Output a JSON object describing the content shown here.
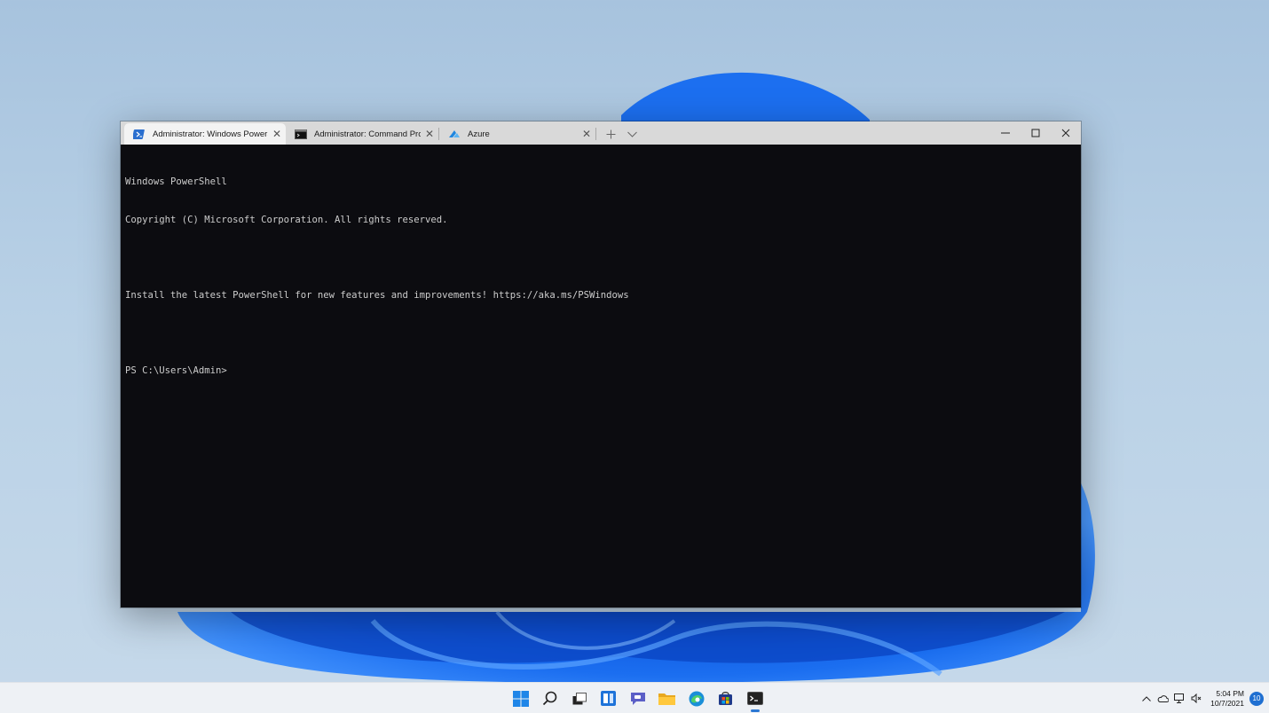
{
  "window": {
    "tabs": [
      {
        "label": "Administrator: Windows PowerS",
        "icon": "powershell-icon",
        "active": true
      },
      {
        "label": "Administrator: Command Promp",
        "icon": "command-prompt-icon",
        "active": false
      },
      {
        "label": "Azure",
        "icon": "azure-icon",
        "active": false
      }
    ],
    "new_tab_glyph": "+",
    "dropdown_glyph": "⌄",
    "close_glyph": "✕"
  },
  "console": {
    "lines": [
      "Windows PowerShell",
      "Copyright (C) Microsoft Corporation. All rights reserved.",
      "",
      "Install the latest PowerShell for new features and improvements! https://aka.ms/PSWindows",
      "",
      "PS C:\\Users\\Admin>"
    ]
  },
  "taskbar": {
    "apps": [
      "start-icon",
      "search-icon",
      "task-view-icon",
      "widgets-icon",
      "teams-chat-icon",
      "file-explorer-icon",
      "edge-icon",
      "store-icon",
      "terminal-icon"
    ],
    "tray": {
      "time": "5:04 PM",
      "date": "10/7/2021",
      "notification_count": "10"
    }
  },
  "colors": {
    "console_bg": "#0c0c10",
    "console_fg": "#cccccc",
    "accent": "#1f6fd1"
  }
}
